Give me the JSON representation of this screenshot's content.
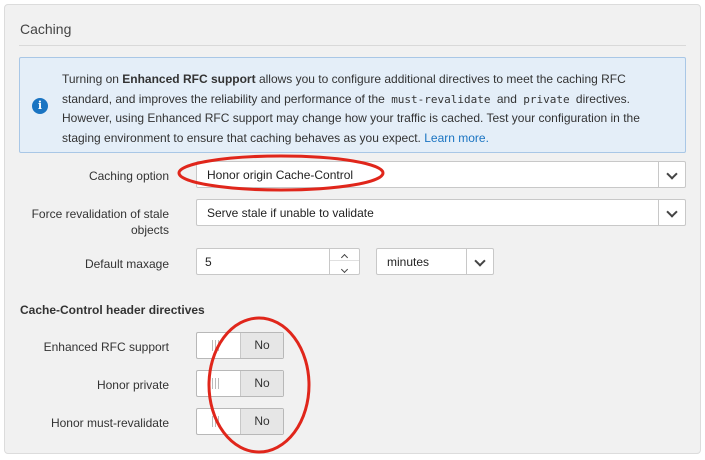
{
  "panel": {
    "title": "Caching"
  },
  "info": {
    "icon": "info-icon",
    "text_1": "Turning on ",
    "bold": "Enhanced RFC support",
    "text_2": " allows you to configure additional directives to meet the caching RFC standard, and improves the reliability and performance of the ",
    "code_1": "must-revalidate",
    "and": " and ",
    "code_2": "private",
    "text_3": " directives. However, using Enhanced RFC support may change how your traffic is cached. Test your configuration in the staging environment to ensure that caching behaves as you expect. ",
    "link": "Learn more."
  },
  "caching_option": {
    "label": "Caching option",
    "value": "Honor origin Cache-Control"
  },
  "force_revalidation": {
    "label": "Force revalidation of stale objects",
    "value": "Serve stale if unable to validate"
  },
  "default_maxage": {
    "label": "Default maxage",
    "value": "5",
    "unit": "minutes"
  },
  "directives": {
    "heading": "Cache-Control header directives",
    "enhanced_rfc": {
      "label": "Enhanced RFC support",
      "state": "No"
    },
    "honor_private": {
      "label": "Honor private",
      "state": "No"
    },
    "honor_must_revalidate": {
      "label": "Honor must-revalidate",
      "state": "No"
    }
  },
  "colors": {
    "accent": "#1a74c2",
    "annotation": "#e0261b",
    "info_bg": "#e4eef8"
  }
}
